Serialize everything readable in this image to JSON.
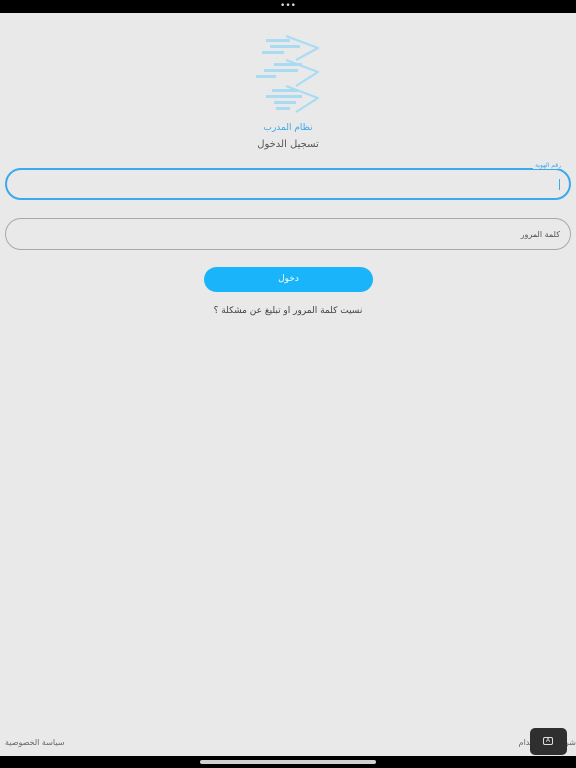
{
  "status_bar": {
    "dots": "•••"
  },
  "branding": {
    "app_name": "نظام المدرب",
    "page_title": "تسجيل الدخول",
    "logo_icon": "arrows-logo-icon",
    "logo_color": "#a9dcf3"
  },
  "form": {
    "id_field": {
      "label": "رقم الهوية",
      "value": ""
    },
    "password_field": {
      "placeholder": "كلمة المرور",
      "value": ""
    },
    "submit_label": "دخول",
    "forgot_label": "نسيت كلمة المرور او تبليغ عن مشكلة ؟"
  },
  "footer": {
    "privacy_label": "سياسة الخصوصية",
    "terms_label": "شروط الاستخدام",
    "keyboard_icon": "keyboard-icon"
  },
  "colors": {
    "accent": "#1ab4fb",
    "focus_border": "#3aa9ee",
    "background": "#e9e9e9"
  }
}
